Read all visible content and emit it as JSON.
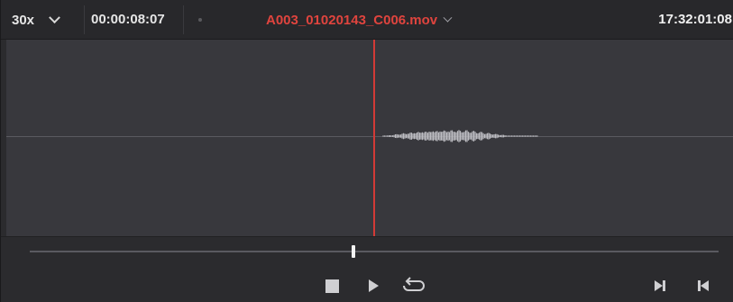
{
  "header": {
    "zoom_label": "30x",
    "source_timecode": "00:00:08:07",
    "clip_name": "A003_01020143_C006.mov",
    "record_timecode": "17:32:01:08"
  },
  "colors": {
    "accent_red": "#e0443e",
    "playhead": "#d33a36",
    "panel_bg": "#2b2b2e",
    "wave_bg": "#38383d"
  },
  "scrubber": {
    "position_fraction": 0.47
  },
  "transport": {
    "stop_icon": "stop-icon",
    "play_icon": "play-icon",
    "loop_icon": "loop-icon",
    "next_icon": "jump-to-next-icon",
    "prev_icon": "jump-to-previous-icon"
  }
}
